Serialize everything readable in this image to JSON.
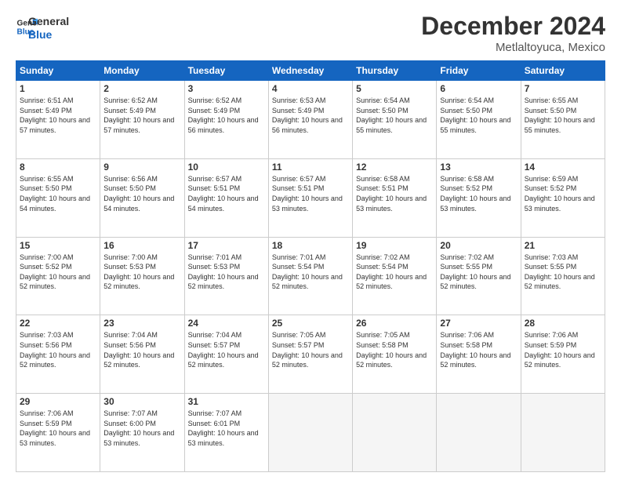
{
  "header": {
    "logo_line1": "General",
    "logo_line2": "Blue",
    "month": "December 2024",
    "location": "Metlaltoyuca, Mexico"
  },
  "weekdays": [
    "Sunday",
    "Monday",
    "Tuesday",
    "Wednesday",
    "Thursday",
    "Friday",
    "Saturday"
  ],
  "weeks": [
    [
      {
        "day": "1",
        "sunrise": "6:51 AM",
        "sunset": "5:49 PM",
        "daylight": "10 hours and 57 minutes."
      },
      {
        "day": "2",
        "sunrise": "6:52 AM",
        "sunset": "5:49 PM",
        "daylight": "10 hours and 57 minutes."
      },
      {
        "day": "3",
        "sunrise": "6:52 AM",
        "sunset": "5:49 PM",
        "daylight": "10 hours and 56 minutes."
      },
      {
        "day": "4",
        "sunrise": "6:53 AM",
        "sunset": "5:49 PM",
        "daylight": "10 hours and 56 minutes."
      },
      {
        "day": "5",
        "sunrise": "6:54 AM",
        "sunset": "5:50 PM",
        "daylight": "10 hours and 55 minutes."
      },
      {
        "day": "6",
        "sunrise": "6:54 AM",
        "sunset": "5:50 PM",
        "daylight": "10 hours and 55 minutes."
      },
      {
        "day": "7",
        "sunrise": "6:55 AM",
        "sunset": "5:50 PM",
        "daylight": "10 hours and 55 minutes."
      }
    ],
    [
      {
        "day": "8",
        "sunrise": "6:55 AM",
        "sunset": "5:50 PM",
        "daylight": "10 hours and 54 minutes."
      },
      {
        "day": "9",
        "sunrise": "6:56 AM",
        "sunset": "5:50 PM",
        "daylight": "10 hours and 54 minutes."
      },
      {
        "day": "10",
        "sunrise": "6:57 AM",
        "sunset": "5:51 PM",
        "daylight": "10 hours and 54 minutes."
      },
      {
        "day": "11",
        "sunrise": "6:57 AM",
        "sunset": "5:51 PM",
        "daylight": "10 hours and 53 minutes."
      },
      {
        "day": "12",
        "sunrise": "6:58 AM",
        "sunset": "5:51 PM",
        "daylight": "10 hours and 53 minutes."
      },
      {
        "day": "13",
        "sunrise": "6:58 AM",
        "sunset": "5:52 PM",
        "daylight": "10 hours and 53 minutes."
      },
      {
        "day": "14",
        "sunrise": "6:59 AM",
        "sunset": "5:52 PM",
        "daylight": "10 hours and 53 minutes."
      }
    ],
    [
      {
        "day": "15",
        "sunrise": "7:00 AM",
        "sunset": "5:52 PM",
        "daylight": "10 hours and 52 minutes."
      },
      {
        "day": "16",
        "sunrise": "7:00 AM",
        "sunset": "5:53 PM",
        "daylight": "10 hours and 52 minutes."
      },
      {
        "day": "17",
        "sunrise": "7:01 AM",
        "sunset": "5:53 PM",
        "daylight": "10 hours and 52 minutes."
      },
      {
        "day": "18",
        "sunrise": "7:01 AM",
        "sunset": "5:54 PM",
        "daylight": "10 hours and 52 minutes."
      },
      {
        "day": "19",
        "sunrise": "7:02 AM",
        "sunset": "5:54 PM",
        "daylight": "10 hours and 52 minutes."
      },
      {
        "day": "20",
        "sunrise": "7:02 AM",
        "sunset": "5:55 PM",
        "daylight": "10 hours and 52 minutes."
      },
      {
        "day": "21",
        "sunrise": "7:03 AM",
        "sunset": "5:55 PM",
        "daylight": "10 hours and 52 minutes."
      }
    ],
    [
      {
        "day": "22",
        "sunrise": "7:03 AM",
        "sunset": "5:56 PM",
        "daylight": "10 hours and 52 minutes."
      },
      {
        "day": "23",
        "sunrise": "7:04 AM",
        "sunset": "5:56 PM",
        "daylight": "10 hours and 52 minutes."
      },
      {
        "day": "24",
        "sunrise": "7:04 AM",
        "sunset": "5:57 PM",
        "daylight": "10 hours and 52 minutes."
      },
      {
        "day": "25",
        "sunrise": "7:05 AM",
        "sunset": "5:57 PM",
        "daylight": "10 hours and 52 minutes."
      },
      {
        "day": "26",
        "sunrise": "7:05 AM",
        "sunset": "5:58 PM",
        "daylight": "10 hours and 52 minutes."
      },
      {
        "day": "27",
        "sunrise": "7:06 AM",
        "sunset": "5:58 PM",
        "daylight": "10 hours and 52 minutes."
      },
      {
        "day": "28",
        "sunrise": "7:06 AM",
        "sunset": "5:59 PM",
        "daylight": "10 hours and 52 minutes."
      }
    ],
    [
      {
        "day": "29",
        "sunrise": "7:06 AM",
        "sunset": "5:59 PM",
        "daylight": "10 hours and 53 minutes."
      },
      {
        "day": "30",
        "sunrise": "7:07 AM",
        "sunset": "6:00 PM",
        "daylight": "10 hours and 53 minutes."
      },
      {
        "day": "31",
        "sunrise": "7:07 AM",
        "sunset": "6:01 PM",
        "daylight": "10 hours and 53 minutes."
      },
      null,
      null,
      null,
      null
    ]
  ]
}
